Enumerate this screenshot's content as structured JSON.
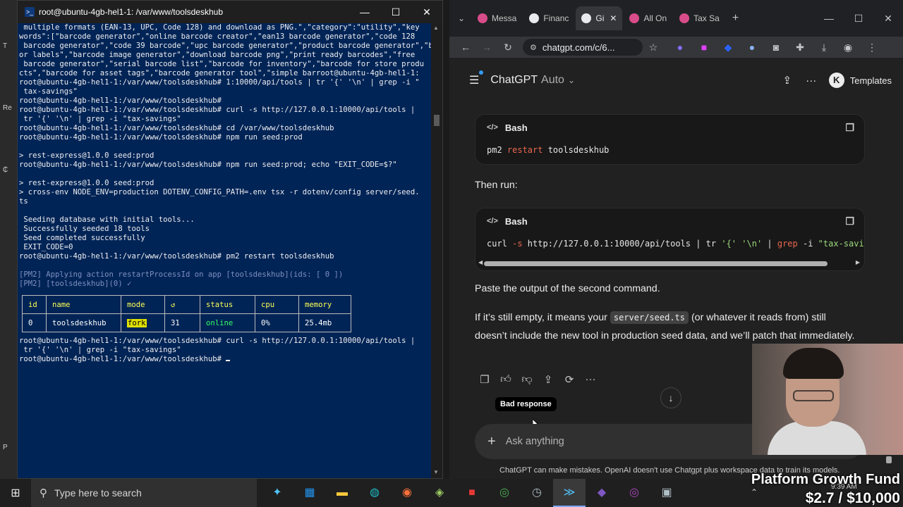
{
  "terminal": {
    "title": "root@ubuntu-4gb-hel1-1: /var/www/toolsdeskhub",
    "lines": [
      " multiple formats (EAN-13, UPC, Code 128) and download as PNG.\",\"category\":\"utility\",\"key",
      "words\":[\"barcode generator\",\"online barcode creator\",\"ean13 barcode generator\",\"code 128",
      " barcode generator\",\"code 39 barcode\",\"upc barcode generator\",\"product barcode generator\",\"barcode f",
      "or labels\",\"barcode image generator\",\"download barcode png\",\"print ready barcodes\",\"free",
      " barcode generator\",\"serial barcode list\",\"barcode for inventory\",\"barcode for store produ",
      "cts\",\"barcode for asset tags\",\"barcode generator tool\",\"simple barroot@ubuntu-4gb-hel1-1:",
      "root@ubuntu-4gb-hel1-1:/var/www/toolsdeskhub# 1:10000/api/tools | tr '{' '\\n' | grep -i \"",
      " tax-savings\"",
      "root@ubuntu-4gb-hel1-1:/var/www/toolsdeskhub#",
      "root@ubuntu-4gb-hel1-1:/var/www/toolsdeskhub# curl -s http://127.0.0.1:10000/api/tools |",
      " tr '{' '\\n' | grep -i \"tax-savings\"",
      "root@ubuntu-4gb-hel1-1:/var/www/toolsdeskhub# cd /var/www/toolsdeskhub",
      "root@ubuntu-4gb-hel1-1:/var/www/toolsdeskhub# npm run seed:prod",
      "",
      "> rest-express@1.0.0 seed:prod",
      "root@ubuntu-4gb-hel1-1:/var/www/toolsdeskhub# npm run seed:prod; echo \"EXIT_CODE=$?\"",
      "",
      "> rest-express@1.0.0 seed:prod",
      "> cross-env NODE_ENV=production DOTENV_CONFIG_PATH=.env tsx -r dotenv/config server/seed.",
      "ts",
      "",
      " Seeding database with initial tools...",
      " Successfully seeded 18 tools",
      " Seed completed successfully",
      " EXIT_CODE=0",
      "root@ubuntu-4gb-hel1-1:/var/www/toolsdeskhub# pm2 restart toolsdeskhub",
      "",
      "[PM2] Applying action restartProcessId on app [toolsdeskhub](ids: [ 0 ])",
      "[PM2] [toolsdeskhub](0) ✓"
    ],
    "table": {
      "headers": [
        "id",
        "name",
        "mode",
        "↺",
        "status",
        "cpu",
        "memory"
      ],
      "rows": [
        [
          "0",
          "toolsdeskhub",
          "fork",
          "31",
          "online",
          "0%",
          "25.4mb"
        ]
      ]
    },
    "after_lines": [
      "root@ubuntu-4gb-hel1-1:/var/www/toolsdeskhub# curl -s http://127.0.0.1:10000/api/tools |",
      " tr '{' '\\n' | grep -i \"tax-savings\"",
      "root@ubuntu-4gb-hel1-1:/var/www/toolsdeskhub# "
    ]
  },
  "browser": {
    "tabs": [
      {
        "label": "Messa",
        "color": "#d84c8a"
      },
      {
        "label": "Financ",
        "color": "#e8eaed"
      },
      {
        "label": "Gi",
        "color": "#e8eaed"
      },
      {
        "label": "All On",
        "color": "#d84c8a"
      },
      {
        "label": "Tax Sa",
        "color": "#d84c8a"
      }
    ],
    "address": "chatgpt.com/c/6...",
    "header": {
      "model": "ChatGPT",
      "mode": "Auto",
      "avatar_letter": "K",
      "templates": "Templates"
    },
    "code_blocks": [
      {
        "lang": "Bash",
        "cmd_pre": "pm2 ",
        "cmd_kw": "restart",
        "cmd_post": " toolsdeskhub"
      },
      {
        "lang": "Bash",
        "cmd_pre": "curl ",
        "cmd_kw": "-s",
        "cmd_mid": " http://127.0.0.1:10000/api/tools | tr ",
        "cmd_str1": "'{'",
        "cmd_mid2": " ",
        "cmd_str2": "'\\n'",
        "cmd_mid3": " | ",
        "cmd_kw2": "grep",
        "cmd_mid4": " -i ",
        "cmd_str3": "\"tax-savin"
      }
    ],
    "then_run": "Then run:",
    "paste_output": "Paste the output of the second command.",
    "if_empty_pre": "If it’s still empty, it means your ",
    "if_empty_code": "server/seed.ts",
    "if_empty_post": " (or whatever it reads from) still doesn’t include the new tool in production seed data, and we’ll patch that immediately.",
    "tooltip": "Bad response",
    "composer_placeholder": "Ask anything",
    "disclaimer": "ChatGPT can make mistakes. OpenAI doesn't use Chatgpt plus workspace data to train its models."
  },
  "taskbar": {
    "search_placeholder": "Type here to search",
    "clock": "9:39 AM"
  },
  "overlay": {
    "line1": "Platform Growth Fund",
    "line2": "$2.7 / $10,000"
  }
}
